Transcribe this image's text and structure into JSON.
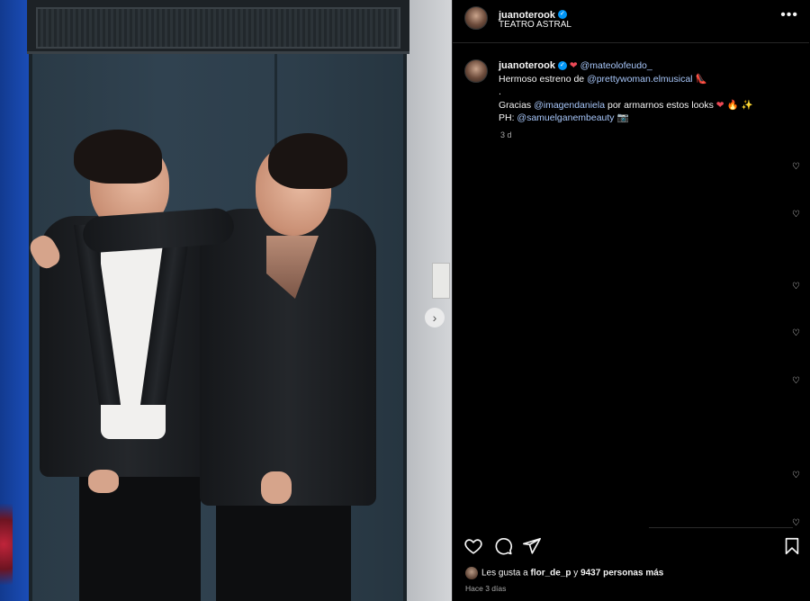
{
  "post": {
    "username": "juanoterook",
    "location": "TEATRO ASTRAL",
    "more_icon": "more-horizontal-icon"
  },
  "caption": {
    "username": "juanoterook",
    "heart": "❤️",
    "mention1": "@mateolofeudo_",
    "line1_prefix": "Hermoso estreno de ",
    "mention2": "@prettywoman.elmusical",
    "line1_emoji": "👠",
    "dot_line": ".",
    "line3_prefix": "Gracias ",
    "mention3": "@imagendaniela",
    "line3_mid": " por armarnos estos looks",
    "line3_emoji": "❤️🔥✨",
    "line4_prefix": "PH: ",
    "mention4": "@samuelganembeauty",
    "line4_emoji": "📸",
    "time": "3 d"
  },
  "actions": {
    "like_icon": "heart-icon",
    "comment_icon": "comment-icon",
    "share_icon": "send-icon",
    "save_icon": "bookmark-icon"
  },
  "likes": {
    "prefix": "Les gusta a ",
    "user": "flor_de_p",
    "middle": " y ",
    "count": "9437 personas más"
  },
  "posted": "Hace 3 días",
  "colors": {
    "mention": "#a8c7fa",
    "verified": "#0095f6",
    "heart": "#ed4956",
    "background": "#000000"
  }
}
